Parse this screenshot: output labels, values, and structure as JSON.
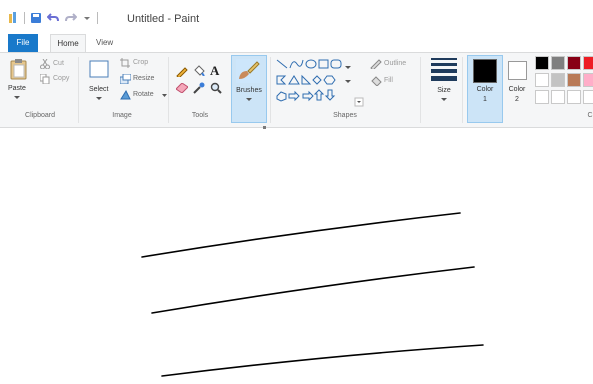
{
  "window": {
    "title": "Untitled - Paint"
  },
  "quick_access": {
    "icons": [
      "paint-app-icon",
      "save-icon",
      "undo-icon",
      "redo-icon",
      "customize-dropdown-icon"
    ]
  },
  "tabs": {
    "file": "File",
    "home": "Home",
    "view": "View"
  },
  "clipboard": {
    "paste": "Paste",
    "cut": "Cut",
    "copy": "Copy",
    "group": "Clipboard"
  },
  "image": {
    "select": "Select",
    "crop": "Crop",
    "resize": "Resize",
    "rotate": "Rotate",
    "group": "Image"
  },
  "tools": {
    "group": "Tools",
    "items": [
      "pencil-icon",
      "fill-bucket-icon",
      "text-icon",
      "eraser-icon",
      "color-picker-icon",
      "magnifier-icon"
    ]
  },
  "brushes": {
    "label": "Brushes"
  },
  "shapes": {
    "outline": "Outline",
    "fill": "Fill",
    "group": "Shapes"
  },
  "size": {
    "label": "Size"
  },
  "colors": {
    "color1_label": "Color",
    "color1_num": "1",
    "color2_label": "Color",
    "color2_num": "2",
    "color1_value": "#000000",
    "color2_value": "#ffffff",
    "group": "C",
    "palette_row1": [
      "#000000",
      "#7f7f7f",
      "#880015",
      "#ed1c24"
    ],
    "palette_row2": [
      "#ffffff",
      "#c3c3c3",
      "#b97a57",
      "#ffaec9"
    ],
    "palette_row3": [
      "#ffffff",
      "#ffffff",
      "#ffffff",
      "#ffffff"
    ]
  },
  "canvas": {
    "strokes": 3,
    "stroke_color": "#000000"
  },
  "accent": "#1979ca"
}
